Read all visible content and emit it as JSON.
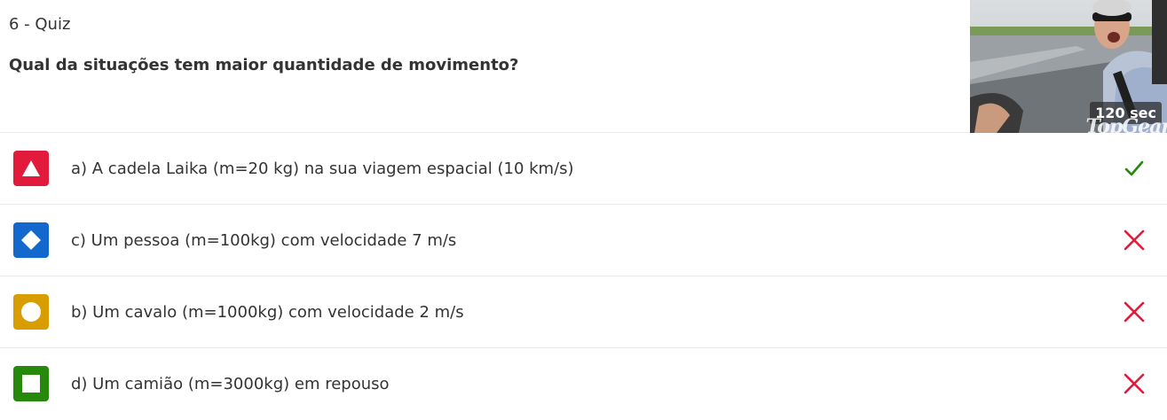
{
  "quiz": {
    "label": "6 - Quiz",
    "question": "Qual da situações tem maior quantidade de movimento?",
    "timer": "120 sec",
    "watermark": "TopGear"
  },
  "colors": {
    "red": "#e21b3c",
    "blue": "#1368ce",
    "yellow": "#d89e00",
    "green": "#26890c",
    "correct": "#26890c",
    "incorrect": "#e21b3c"
  },
  "options": [
    {
      "shape": "triangle-icon",
      "color": "#e21b3c",
      "text": "a) A cadela Laika (m=20 kg) na sua viagem espacial (10 km/s)",
      "result": "correct"
    },
    {
      "shape": "diamond-icon",
      "color": "#1368ce",
      "text": "c) Um pessoa (m=100kg) com velocidade 7 m/s",
      "result": "incorrect"
    },
    {
      "shape": "circle-icon",
      "color": "#d89e00",
      "text": "b) Um cavalo (m=1000kg) com velocidade 2 m/s",
      "result": "incorrect"
    },
    {
      "shape": "square-icon",
      "color": "#26890c",
      "text": "d) Um camião (m=3000kg) em repouso",
      "result": "incorrect"
    }
  ]
}
